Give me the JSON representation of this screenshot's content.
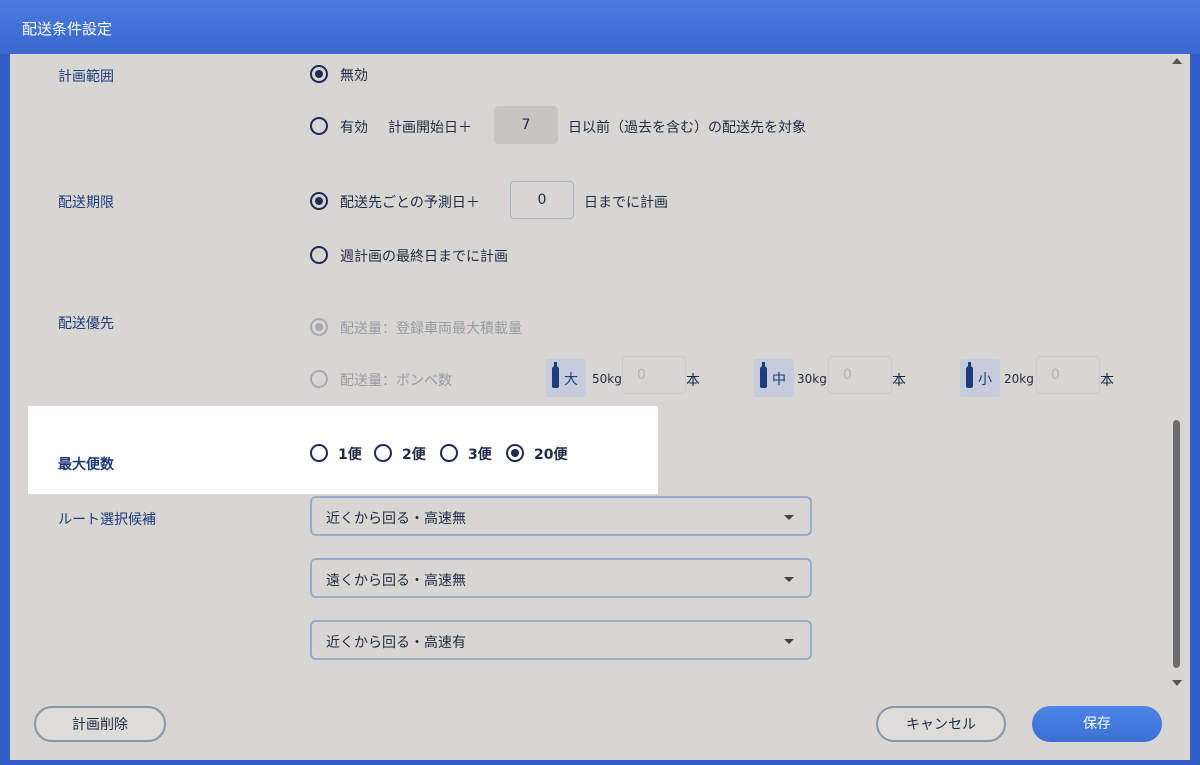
{
  "window": {
    "title": "配送条件設定"
  },
  "plan_range": {
    "label": "計画範囲",
    "options": [
      {
        "text": "無効",
        "checked": true
      },
      {
        "text": "有効",
        "checked": false
      }
    ],
    "prefix": "計画開始日＋",
    "days": "7",
    "suffix": "日以前（過去を含む）の配送先を対象"
  },
  "delivery_deadline": {
    "label": "配送期限",
    "option1_prefix": "配送先ごとの予測日＋",
    "days": "0",
    "option1_suffix": "日までに計画",
    "option2": "週計画の最終日までに計画"
  },
  "delivery_priority": {
    "label": "配送優先",
    "option1": "配送量：登録車両最大積載量",
    "option2": "配送量：ボンベ数",
    "cylinders": [
      {
        "size": "大",
        "weight": "50kg",
        "count": "0",
        "unit": "本"
      },
      {
        "size": "中",
        "weight": "30kg",
        "count": "0",
        "unit": "本"
      },
      {
        "size": "小",
        "weight": "20kg",
        "count": "0",
        "unit": "本"
      }
    ]
  },
  "max_trips": {
    "label": "最大便数",
    "options": [
      {
        "text": "1便",
        "checked": false
      },
      {
        "text": "2便",
        "checked": false
      },
      {
        "text": "3便",
        "checked": false
      },
      {
        "text": "20便",
        "checked": true
      }
    ]
  },
  "route_candidates": {
    "label": "ルート選択候補",
    "selects": [
      "近くから回る・高速無",
      "遠くから回る・高速無",
      "近くから回る・高速有"
    ]
  },
  "footer": {
    "delete_label": "計画削除",
    "cancel_label": "キャンセル",
    "save_label": "保存"
  },
  "colors": {
    "title_bar": "#3a68cf",
    "panel": "#d8d6d3",
    "accent": "#1f2a55",
    "primary_button": "#3a6fd4"
  }
}
